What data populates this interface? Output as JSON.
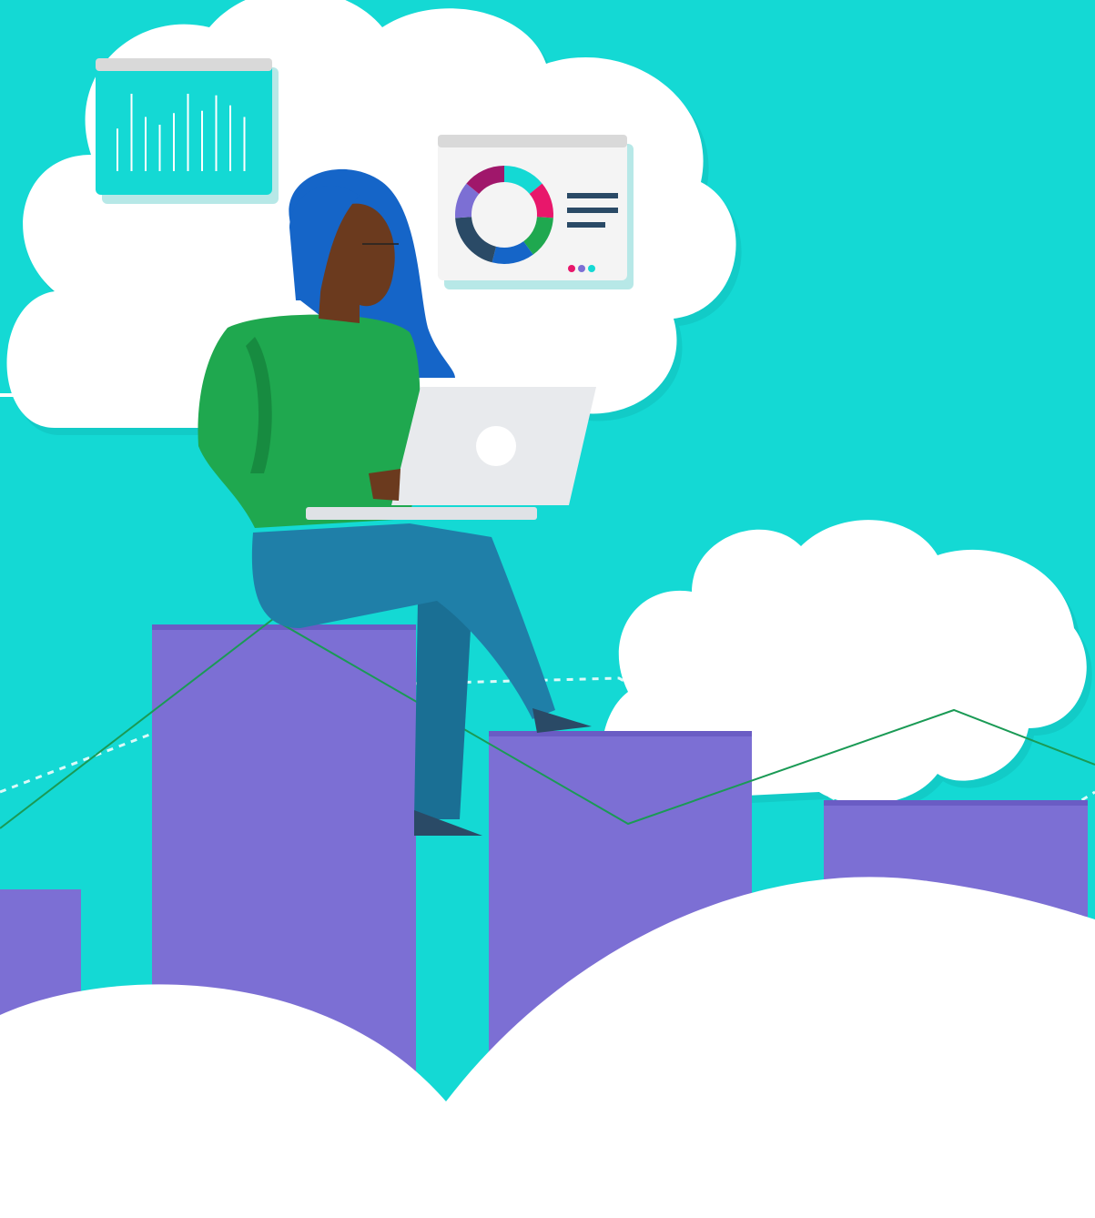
{
  "scene": {
    "colors": {
      "sky": "#14d9d4",
      "bar": "#7c6fd4",
      "bar_shade": "#6a5cc4",
      "cloud": "#ffffff",
      "cloud_shadow": "#0fb3ae",
      "sweater": "#1fa84f",
      "pants": "#1f7fa8",
      "hair": "#1565c8",
      "skin": "#6b3a1e",
      "laptop": "#e8eaed",
      "trend_line": "#1a9a55",
      "dashed_line": "#ffffff"
    },
    "bar_count": 4,
    "donut_segment_colors": [
      "#14d9d4",
      "#e8176b",
      "#1fa84f",
      "#1565c8",
      "#2a4a66",
      "#7c6fd4",
      "#a0176b"
    ],
    "legend_dot_colors": [
      "#e8176b",
      "#7c6fd4",
      "#14d9d4"
    ],
    "mini_bar_levels": [
      0.55,
      1.0,
      0.7,
      0.6,
      0.75,
      1.0,
      0.78,
      0.98,
      0.85,
      0.7
    ]
  }
}
